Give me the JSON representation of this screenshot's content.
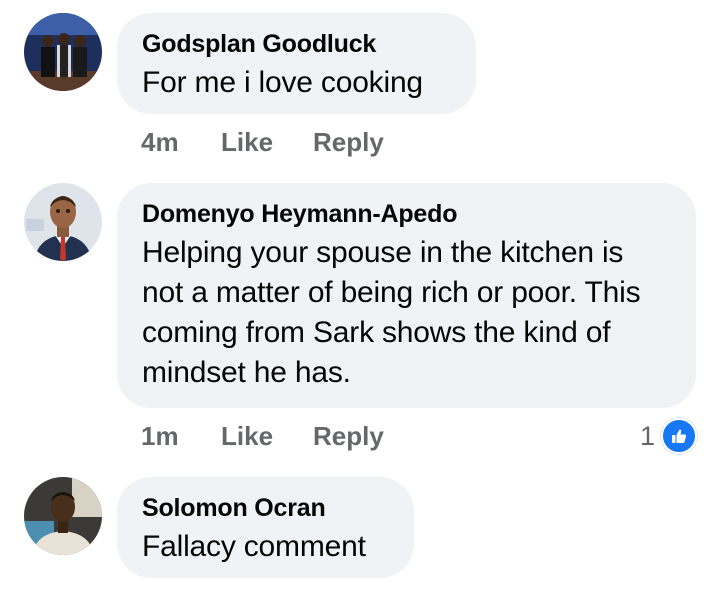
{
  "comments": [
    {
      "author": "Godsplan Goodluck",
      "text": "For me i love cooking",
      "time": "4m",
      "like_label": "Like",
      "reply_label": "Reply"
    },
    {
      "author": "Domenyo Heymann-Apedo",
      "text": "Helping your spouse in the kitchen is not a matter of being rich or poor. This coming from Sark shows the kind of mindset he has.",
      "time": "1m",
      "like_label": "Like",
      "reply_label": "Reply",
      "reaction_count": "1",
      "reaction_icon": "thumbs-up-icon"
    },
    {
      "author": "Solomon Ocran",
      "text": "Fallacy comment"
    }
  ],
  "colors": {
    "bubble": "#f0f2f5",
    "meta_text": "#65676b",
    "like_blue": "#1877f2"
  }
}
